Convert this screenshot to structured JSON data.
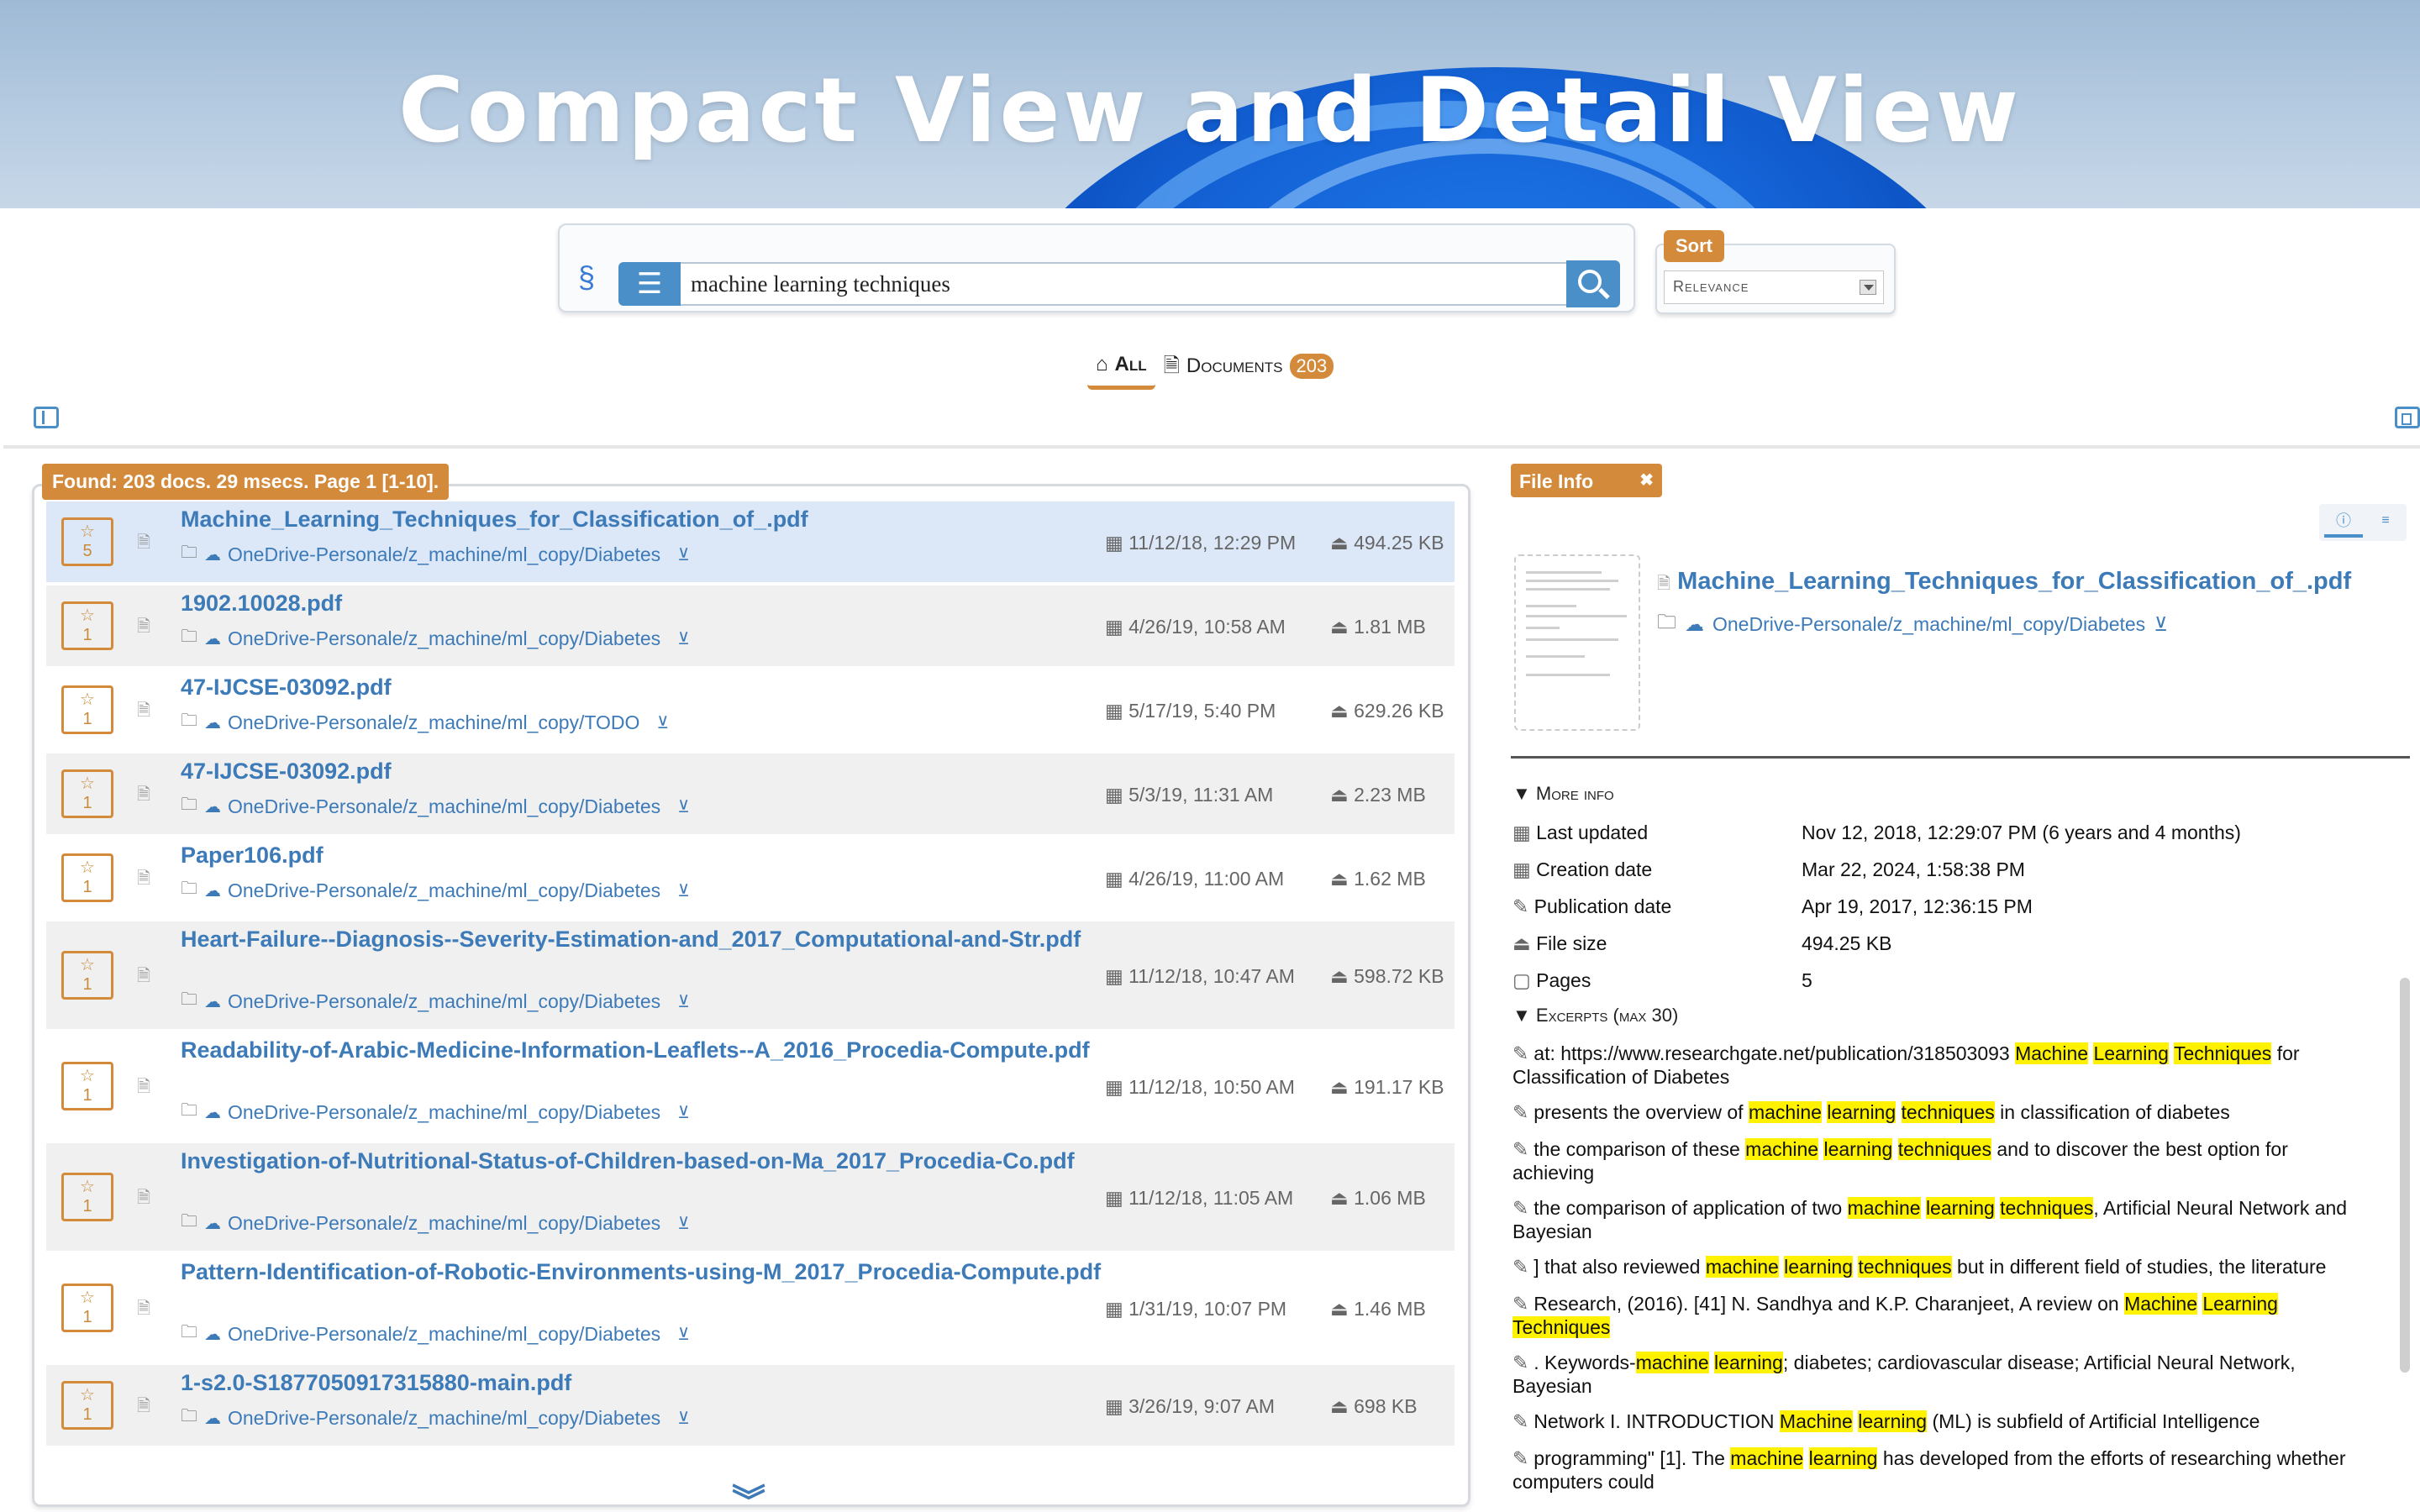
{
  "banner": {
    "title": "Compact View and Detail View"
  },
  "search": {
    "query": "machine learning techniques"
  },
  "sort": {
    "label": "Sort",
    "selected": "Relevance"
  },
  "tabs": [
    {
      "label": "All",
      "icon": "house-icon",
      "active": true
    },
    {
      "label": "Documents",
      "icon": "document-icon",
      "count": "203"
    }
  ],
  "results": {
    "summary": "Found: 203 docs. 29 msecs. Page 1 [1-10].",
    "items": [
      {
        "title": "Machine_Learning_Techniques_for_Classification_of_.pdf",
        "path": "OneDrive-Personale/z_machine/ml_copy/Diabetes",
        "date": "11/12/18, 12:29 PM",
        "size": "494.25 KB",
        "stars": "5"
      },
      {
        "title": "1902.10028.pdf",
        "path": "OneDrive-Personale/z_machine/ml_copy/Diabetes",
        "date": "4/26/19, 10:58 AM",
        "size": "1.81 MB",
        "stars": "1"
      },
      {
        "title": "47-IJCSE-03092.pdf",
        "path": "OneDrive-Personale/z_machine/ml_copy/TODO",
        "date": "5/17/19, 5:40 PM",
        "size": "629.26 KB",
        "stars": "1"
      },
      {
        "title": "47-IJCSE-03092.pdf",
        "path": "OneDrive-Personale/z_machine/ml_copy/Diabetes",
        "date": "5/3/19, 11:31 AM",
        "size": "2.23 MB",
        "stars": "1"
      },
      {
        "title": "Paper106.pdf",
        "path": "OneDrive-Personale/z_machine/ml_copy/Diabetes",
        "date": "4/26/19, 11:00 AM",
        "size": "1.62 MB",
        "stars": "1"
      },
      {
        "title": "Heart-Failure--Diagnosis--Severity-Estimation-and_2017_Computational-and-Str.pdf",
        "path": "OneDrive-Personale/z_machine/ml_copy/Diabetes",
        "date": "11/12/18, 10:47 AM",
        "size": "598.72 KB",
        "stars": "1"
      },
      {
        "title": "Readability-of-Arabic-Medicine-Information-Leaflets--A_2016_Procedia-Compute.pdf",
        "path": "OneDrive-Personale/z_machine/ml_copy/Diabetes",
        "date": "11/12/18, 10:50 AM",
        "size": "191.17 KB",
        "stars": "1"
      },
      {
        "title": "Investigation-of-Nutritional-Status-of-Children-based-on-Ma_2017_Procedia-Co.pdf",
        "path": "OneDrive-Personale/z_machine/ml_copy/Diabetes",
        "date": "11/12/18, 11:05 AM",
        "size": "1.06 MB",
        "stars": "1"
      },
      {
        "title": "Pattern-Identification-of-Robotic-Environments-using-M_2017_Procedia-Compute.pdf",
        "path": "OneDrive-Personale/z_machine/ml_copy/Diabetes",
        "date": "1/31/19, 10:07 PM",
        "size": "1.46 MB",
        "stars": "1"
      },
      {
        "title": "1-s2.0-S1877050917315880-main.pdf",
        "path": "OneDrive-Personale/z_machine/ml_copy/Diabetes",
        "date": "3/26/19, 9:07 AM",
        "size": "698 KB",
        "stars": "1"
      }
    ]
  },
  "file_info": {
    "badge": "File Info",
    "title": "Machine_Learning_Techniques_for_Classification_of_.pdf",
    "path": "OneDrive-Personale/z_machine/ml_copy/Diabetes",
    "more_info_label": "More info",
    "meta": [
      {
        "label": "Last updated",
        "value": "Nov 12, 2018, 12:29:07 PM (6 years and 4 months)"
      },
      {
        "label": "Creation date",
        "value": "Mar 22, 2024, 1:58:38 PM"
      },
      {
        "label": "Publication date",
        "value": "Apr 19, 2017, 12:36:15 PM"
      },
      {
        "label": "File size",
        "value": "494.25 KB"
      },
      {
        "label": "Pages",
        "value": "5"
      }
    ],
    "excerpts_label": "Excerpts (max 30)",
    "excerpts": [
      [
        {
          "t": "at: https://www.researchgate.net/publication/318503093 "
        },
        {
          "t": "Machine",
          "h": true
        },
        {
          "t": " "
        },
        {
          "t": "Learning",
          "h": true
        },
        {
          "t": " "
        },
        {
          "t": "Techniques",
          "h": true
        },
        {
          "t": " for Classification of Diabetes"
        }
      ],
      [
        {
          "t": "presents the overview of "
        },
        {
          "t": "machine",
          "h": true
        },
        {
          "t": " "
        },
        {
          "t": "learning",
          "h": true
        },
        {
          "t": " "
        },
        {
          "t": "techniques",
          "h": true
        },
        {
          "t": " in classification of diabetes"
        }
      ],
      [
        {
          "t": "the comparison of these "
        },
        {
          "t": "machine",
          "h": true
        },
        {
          "t": " "
        },
        {
          "t": "learning",
          "h": true
        },
        {
          "t": " "
        },
        {
          "t": "techniques",
          "h": true
        },
        {
          "t": " and to discover the best option for achieving"
        }
      ],
      [
        {
          "t": "the comparison of application of two "
        },
        {
          "t": "machine",
          "h": true
        },
        {
          "t": " "
        },
        {
          "t": "learning",
          "h": true
        },
        {
          "t": " "
        },
        {
          "t": "techniques",
          "h": true
        },
        {
          "t": ", Artificial Neural Network and Bayesian"
        }
      ],
      [
        {
          "t": "] that also reviewed "
        },
        {
          "t": "machine",
          "h": true
        },
        {
          "t": " "
        },
        {
          "t": "learning",
          "h": true
        },
        {
          "t": " "
        },
        {
          "t": "techniques",
          "h": true
        },
        {
          "t": " but in different field of studies, the literature"
        }
      ],
      [
        {
          "t": "Research, (2016). [41] N. Sandhya and K.P. Charanjeet, A review on "
        },
        {
          "t": "Machine",
          "h": true
        },
        {
          "t": " "
        },
        {
          "t": "Learning",
          "h": true
        },
        {
          "t": " "
        },
        {
          "t": "Techniques",
          "h": true
        }
      ],
      [
        {
          "t": ". Keywords-"
        },
        {
          "t": "machine",
          "h": true
        },
        {
          "t": " "
        },
        {
          "t": "learning",
          "h": true
        },
        {
          "t": "; diabetes; cardiovascular disease; Artificial Neural Network, Bayesian"
        }
      ],
      [
        {
          "t": "Network I. INTRODUCTION "
        },
        {
          "t": "Machine",
          "h": true
        },
        {
          "t": " "
        },
        {
          "t": "learning",
          "h": true
        },
        {
          "t": " (ML) is subfield of Artificial Intelligence"
        }
      ],
      [
        {
          "t": "programming\" [1]. The "
        },
        {
          "t": "machine",
          "h": true
        },
        {
          "t": " "
        },
        {
          "t": "learning",
          "h": true
        },
        {
          "t": " has developed from the efforts of researching whether computers could"
        }
      ]
    ]
  },
  "colors": {
    "accent": "#d38a3a",
    "link": "#3d7ab8",
    "primary": "#4b8fc9",
    "highlight": "#fff200"
  }
}
